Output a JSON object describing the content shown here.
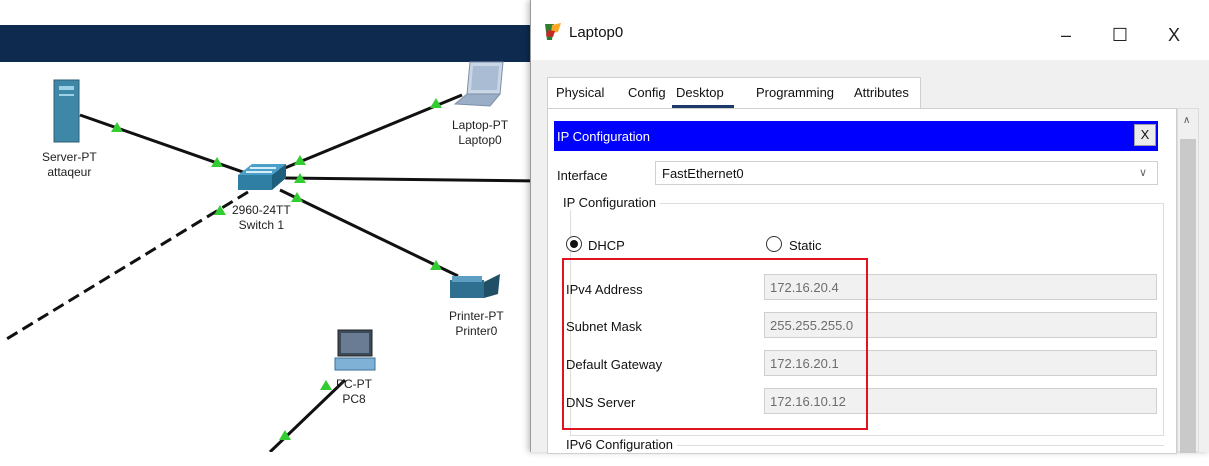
{
  "topology": {
    "devices": [
      {
        "type": "Server-PT",
        "name": "attaqeur"
      },
      {
        "type": "2960-24TT",
        "name": "Switch 1"
      },
      {
        "type": "Laptop-PT",
        "name": "Laptop0"
      },
      {
        "type": "Printer-PT",
        "name": "Printer0"
      },
      {
        "type": "PC-PT",
        "name": "PC8"
      }
    ]
  },
  "window": {
    "title": "Laptop0",
    "minimize": "–",
    "maximize": "☐",
    "close": "X"
  },
  "tabs": [
    {
      "label": "Physical"
    },
    {
      "label": "Config"
    },
    {
      "label": "Desktop",
      "active": true
    },
    {
      "label": "Programming"
    },
    {
      "label": "Attributes"
    }
  ],
  "ip_config": {
    "header": "IP Configuration",
    "close_label": "X",
    "interface_label": "Interface",
    "interface_value": "FastEthernet0",
    "group_title": "IP Configuration",
    "dhcp_label": "DHCP",
    "static_label": "Static",
    "mode": "DHCP",
    "fields": [
      {
        "label": "IPv4 Address",
        "value": "172.16.20.4"
      },
      {
        "label": "Subnet Mask",
        "value": "255.255.255.0"
      },
      {
        "label": "Default Gateway",
        "value": "172.16.20.1"
      },
      {
        "label": "DNS Server",
        "value": "172.16.10.12"
      }
    ],
    "ipv6_title": "IPv6 Configuration"
  },
  "colors": {
    "topbar": "#0e2a4f",
    "header_blue": "#0000ff",
    "link_green": "#33cc33",
    "highlight_red": "#e0141e"
  }
}
